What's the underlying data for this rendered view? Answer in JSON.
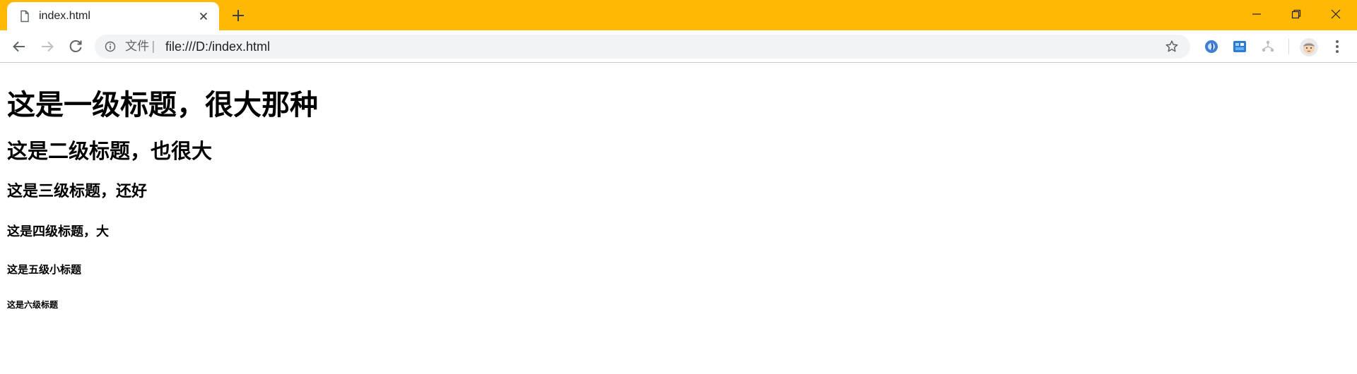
{
  "browser": {
    "tab": {
      "title": "index.html"
    },
    "address_bar": {
      "chip_label": "文件",
      "separator": "|",
      "url": "file:///D:/index.html"
    },
    "colors": {
      "tab_strip": "#ffb803",
      "toolbar": "#ffffff",
      "omnibox": "#f1f3f4"
    },
    "icons": {
      "tab": "file-icon",
      "tab_close": "close-icon",
      "new_tab": "plus-icon",
      "back": "arrow-left-icon",
      "forward": "arrow-right-icon",
      "reload": "reload-icon",
      "site_info": "info-icon",
      "bookmark": "star-icon",
      "extensions": [
        "extension-icon",
        "extension-icon",
        "extension-icon"
      ],
      "profile": "avatar",
      "menu": "kebab-menu-icon",
      "window": [
        "minimize-icon",
        "restore-icon",
        "close-icon"
      ]
    }
  },
  "page": {
    "h1": "这是一级标题，很大那种",
    "h2": "这是二级标题，也很大",
    "h3": "这是三级标题，还好",
    "h4": "这是四级标题，大",
    "h5": "这是五级小标题",
    "h6": "这是六级标题"
  }
}
